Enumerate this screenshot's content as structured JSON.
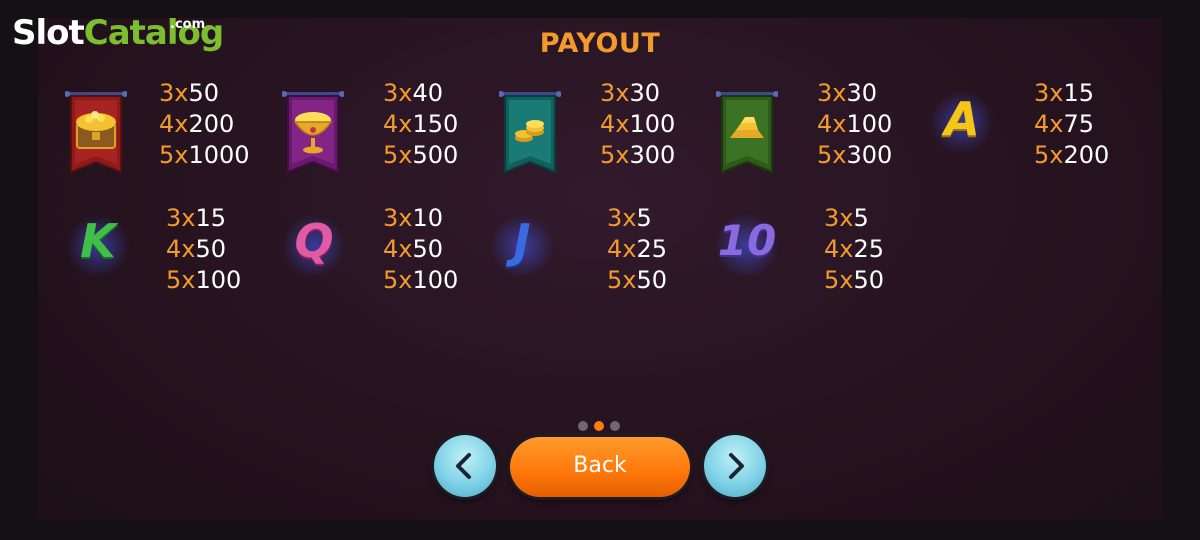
{
  "logo": {
    "slot": "Slot",
    "catalog": "Catalog",
    "com": ".com"
  },
  "title": "PAYOUT",
  "symbols": [
    {
      "name": "treasure-chest",
      "pays": [
        {
          "count": "3x",
          "value": "50"
        },
        {
          "count": "4x",
          "value": "200"
        },
        {
          "count": "5x",
          "value": "1000"
        }
      ]
    },
    {
      "name": "golden-chalice",
      "pays": [
        {
          "count": "3x",
          "value": "40"
        },
        {
          "count": "4x",
          "value": "150"
        },
        {
          "count": "5x",
          "value": "500"
        }
      ]
    },
    {
      "name": "gold-coins",
      "pays": [
        {
          "count": "3x",
          "value": "30"
        },
        {
          "count": "4x",
          "value": "100"
        },
        {
          "count": "5x",
          "value": "300"
        }
      ]
    },
    {
      "name": "gold-bars",
      "pays": [
        {
          "count": "3x",
          "value": "30"
        },
        {
          "count": "4x",
          "value": "100"
        },
        {
          "count": "5x",
          "value": "300"
        }
      ]
    },
    {
      "name": "letter-a",
      "glyph": "A",
      "pays": [
        {
          "count": "3x",
          "value": "15"
        },
        {
          "count": "4x",
          "value": "75"
        },
        {
          "count": "5x",
          "value": "200"
        }
      ]
    },
    {
      "name": "letter-k",
      "glyph": "K",
      "pays": [
        {
          "count": "3x",
          "value": "15"
        },
        {
          "count": "4x",
          "value": "50"
        },
        {
          "count": "5x",
          "value": "100"
        }
      ]
    },
    {
      "name": "letter-q",
      "glyph": "Q",
      "pays": [
        {
          "count": "3x",
          "value": "10"
        },
        {
          "count": "4x",
          "value": "50"
        },
        {
          "count": "5x",
          "value": "100"
        }
      ]
    },
    {
      "name": "letter-j",
      "glyph": "J",
      "pays": [
        {
          "count": "3x",
          "value": "5"
        },
        {
          "count": "4x",
          "value": "25"
        },
        {
          "count": "5x",
          "value": "50"
        }
      ]
    },
    {
      "name": "number-10",
      "glyph": "10",
      "pays": [
        {
          "count": "3x",
          "value": "5"
        },
        {
          "count": "4x",
          "value": "25"
        },
        {
          "count": "5x",
          "value": "50"
        }
      ]
    }
  ],
  "pager": {
    "pages": 3,
    "current": 2
  },
  "buttons": {
    "back_label": "Back",
    "prev_icon": "chevron-left-icon",
    "next_icon": "chevron-right-icon"
  },
  "colors": {
    "accent": "#f29a2c",
    "button_orange": "#ff7a0c",
    "nav_button": "#7fd2e6",
    "logo_green": "#7cbf2e"
  }
}
